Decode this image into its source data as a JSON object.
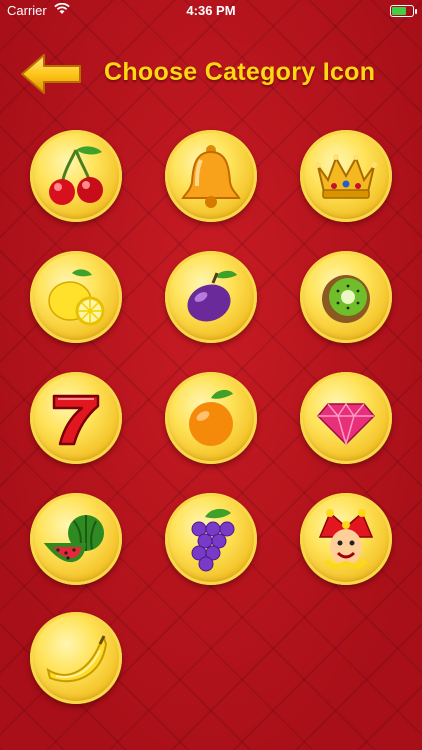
{
  "status_bar": {
    "carrier": "Carrier",
    "time": "4:36 PM"
  },
  "header": {
    "title": "Choose Category Icon",
    "back_icon": "back-arrow-icon"
  },
  "icons": [
    {
      "name": "cherries-icon"
    },
    {
      "name": "bell-icon"
    },
    {
      "name": "crown-icon"
    },
    {
      "name": "lemon-icon"
    },
    {
      "name": "plum-icon"
    },
    {
      "name": "kiwi-icon"
    },
    {
      "name": "seven-icon"
    },
    {
      "name": "orange-icon"
    },
    {
      "name": "diamond-icon"
    },
    {
      "name": "watermelon-icon"
    },
    {
      "name": "grapes-icon"
    },
    {
      "name": "jester-icon"
    },
    {
      "name": "banana-icon"
    }
  ],
  "colors": {
    "background": "#b5121b",
    "title": "#ffd814",
    "coin": "#f3c227"
  }
}
